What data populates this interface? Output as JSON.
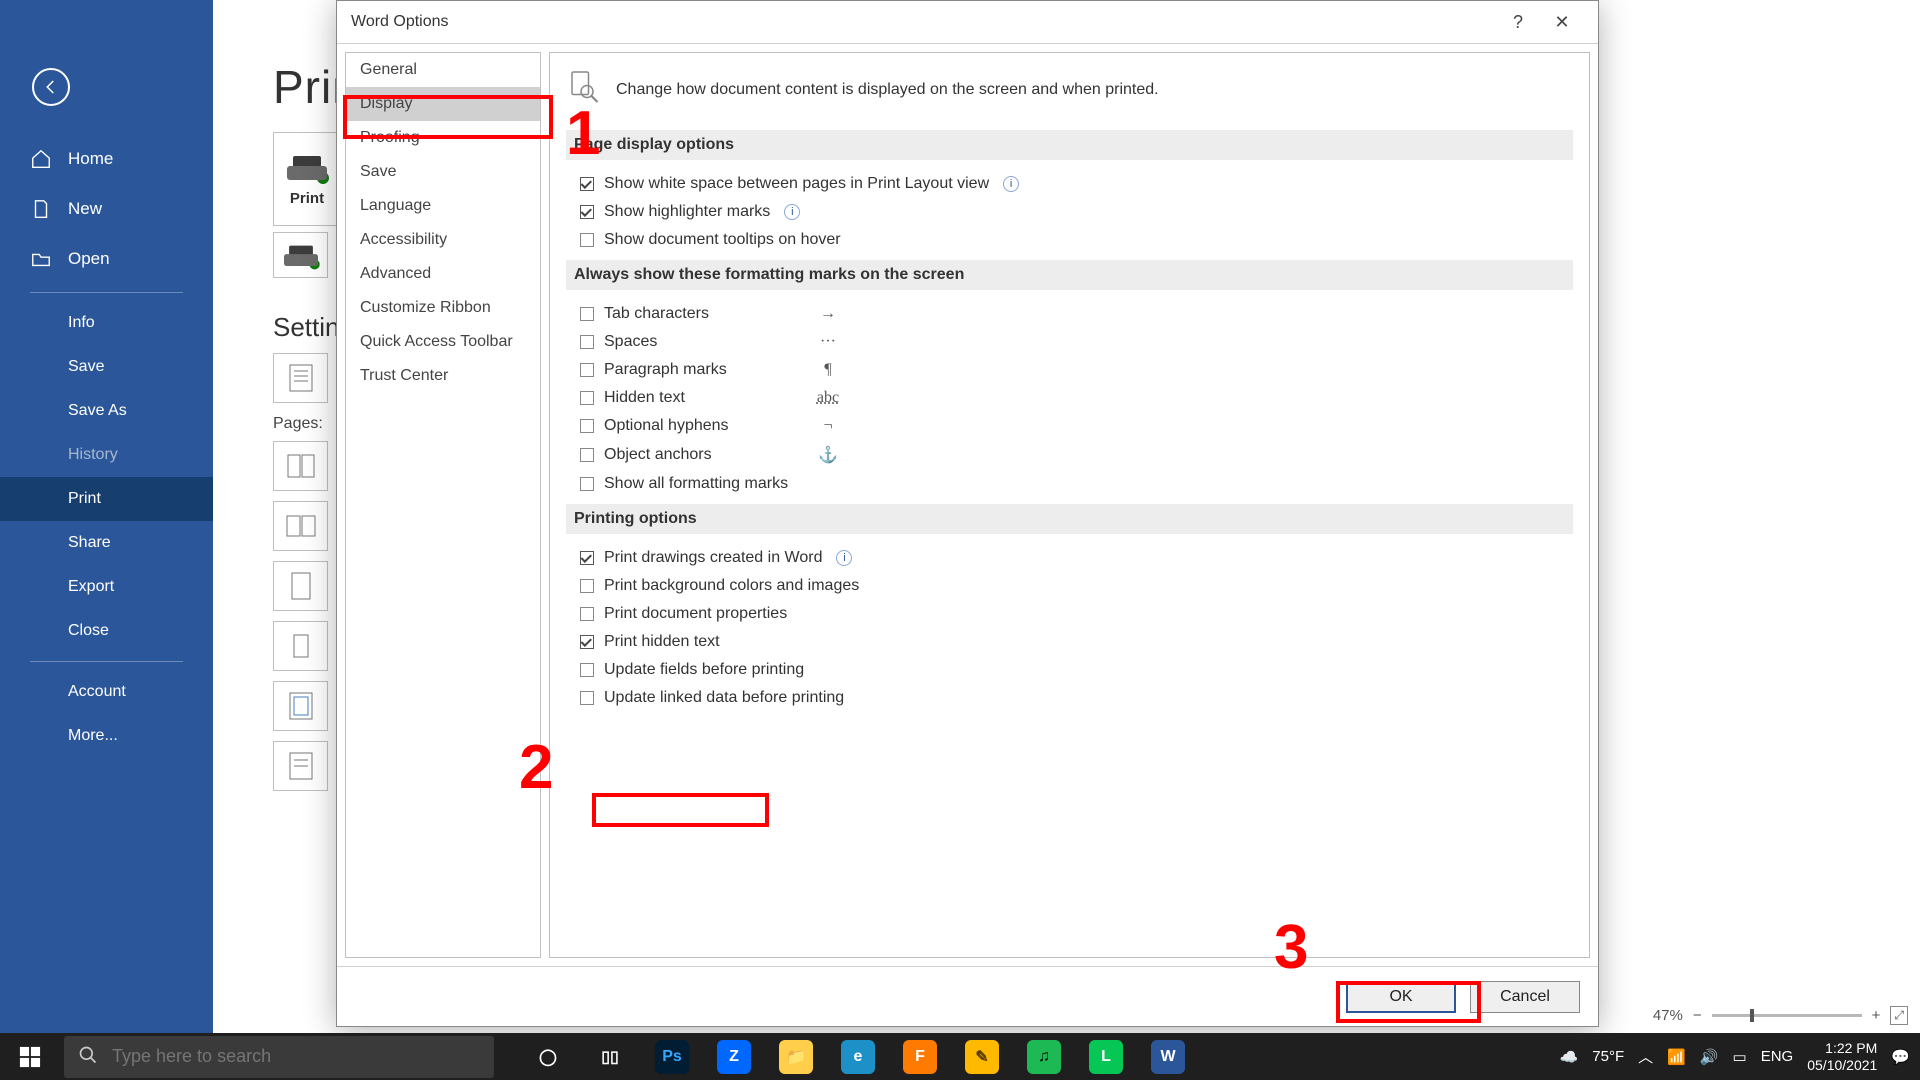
{
  "backstage": {
    "items": [
      {
        "label": "Home",
        "icon": "home"
      },
      {
        "label": "New",
        "icon": "new"
      },
      {
        "label": "Open",
        "icon": "open"
      }
    ],
    "file_items": [
      {
        "label": "Info"
      },
      {
        "label": "Save"
      },
      {
        "label": "Save As"
      },
      {
        "label": "History",
        "dim": true
      },
      {
        "label": "Print",
        "selected": true
      },
      {
        "label": "Share"
      },
      {
        "label": "Export"
      },
      {
        "label": "Close"
      }
    ],
    "bottom_items": [
      {
        "label": "Account"
      },
      {
        "label": "More..."
      }
    ]
  },
  "print": {
    "title": "Print",
    "button_label": "Print",
    "settings_heading": "Settings",
    "pages_label": "Pages:"
  },
  "zoom": {
    "percent": "47%"
  },
  "dialog": {
    "title": "Word Options",
    "categories": [
      "General",
      "Display",
      "Proofing",
      "Save",
      "Language",
      "Accessibility",
      "Advanced",
      "Customize Ribbon",
      "Quick Access Toolbar",
      "Trust Center"
    ],
    "selected_category": "Display",
    "intro": "Change how document content is displayed on the screen and when printed.",
    "sections": {
      "page_display": {
        "title": "Page display options",
        "opts": [
          {
            "label": "Show white space between pages in Print Layout view",
            "checked": true,
            "info": true
          },
          {
            "label": "Show highlighter marks",
            "checked": true,
            "info": true
          },
          {
            "label": "Show document tooltips on hover",
            "checked": false
          }
        ]
      },
      "formatting": {
        "title": "Always show these formatting marks on the screen",
        "opts": [
          {
            "label": "Tab characters",
            "sym": "→"
          },
          {
            "label": "Spaces",
            "sym": "···"
          },
          {
            "label": "Paragraph marks",
            "sym": "¶"
          },
          {
            "label": "Hidden text",
            "sym": "abc"
          },
          {
            "label": "Optional hyphens",
            "sym": "¬"
          },
          {
            "label": "Object anchors",
            "sym": "⚓"
          },
          {
            "label": "Show all formatting marks"
          }
        ]
      },
      "printing": {
        "title": "Printing options",
        "opts": [
          {
            "label": "Print drawings created in Word",
            "checked": true,
            "info": true
          },
          {
            "label": "Print background colors and images",
            "checked": false
          },
          {
            "label": "Print document properties",
            "checked": false
          },
          {
            "label": "Print hidden text",
            "checked": true
          },
          {
            "label": "Update fields before printing",
            "checked": false
          },
          {
            "label": "Update linked data before printing",
            "checked": false
          }
        ]
      }
    },
    "ok": "OK",
    "cancel": "Cancel"
  },
  "annotations": {
    "n1": "1",
    "n2": "2",
    "n3": "3"
  },
  "taskbar": {
    "search_placeholder": "Type here to search",
    "weather": "75°F",
    "lang": "ENG",
    "time": "1:22 PM",
    "date": "05/10/2021",
    "apps": [
      {
        "name": "cortana",
        "bg": "transparent",
        "fg": "#fff",
        "glyph": "◯"
      },
      {
        "name": "taskview",
        "bg": "transparent",
        "fg": "#fff",
        "glyph": "▯▯"
      },
      {
        "name": "photoshop",
        "bg": "#001d34",
        "fg": "#31a8ff",
        "glyph": "Ps"
      },
      {
        "name": "zalo",
        "bg": "#0068ff",
        "fg": "#fff",
        "glyph": "Z"
      },
      {
        "name": "explorer",
        "bg": "#ffcf4b",
        "fg": "#805700",
        "glyph": "📁"
      },
      {
        "name": "edge",
        "bg": "#1e90c8",
        "fg": "#fff",
        "glyph": "e"
      },
      {
        "name": "foxit",
        "bg": "#ff7a00",
        "fg": "#fff",
        "glyph": "F"
      },
      {
        "name": "notes",
        "bg": "#ffb900",
        "fg": "#5a3e00",
        "glyph": "✎"
      },
      {
        "name": "spotify",
        "bg": "#1db954",
        "fg": "#0a0a0a",
        "glyph": "♫"
      },
      {
        "name": "line",
        "bg": "#06c755",
        "fg": "#fff",
        "glyph": "L"
      },
      {
        "name": "word",
        "bg": "#2b579a",
        "fg": "#fff",
        "glyph": "W"
      }
    ]
  },
  "window_controls": {
    "min": "—",
    "max": "▢",
    "close": "✕"
  }
}
